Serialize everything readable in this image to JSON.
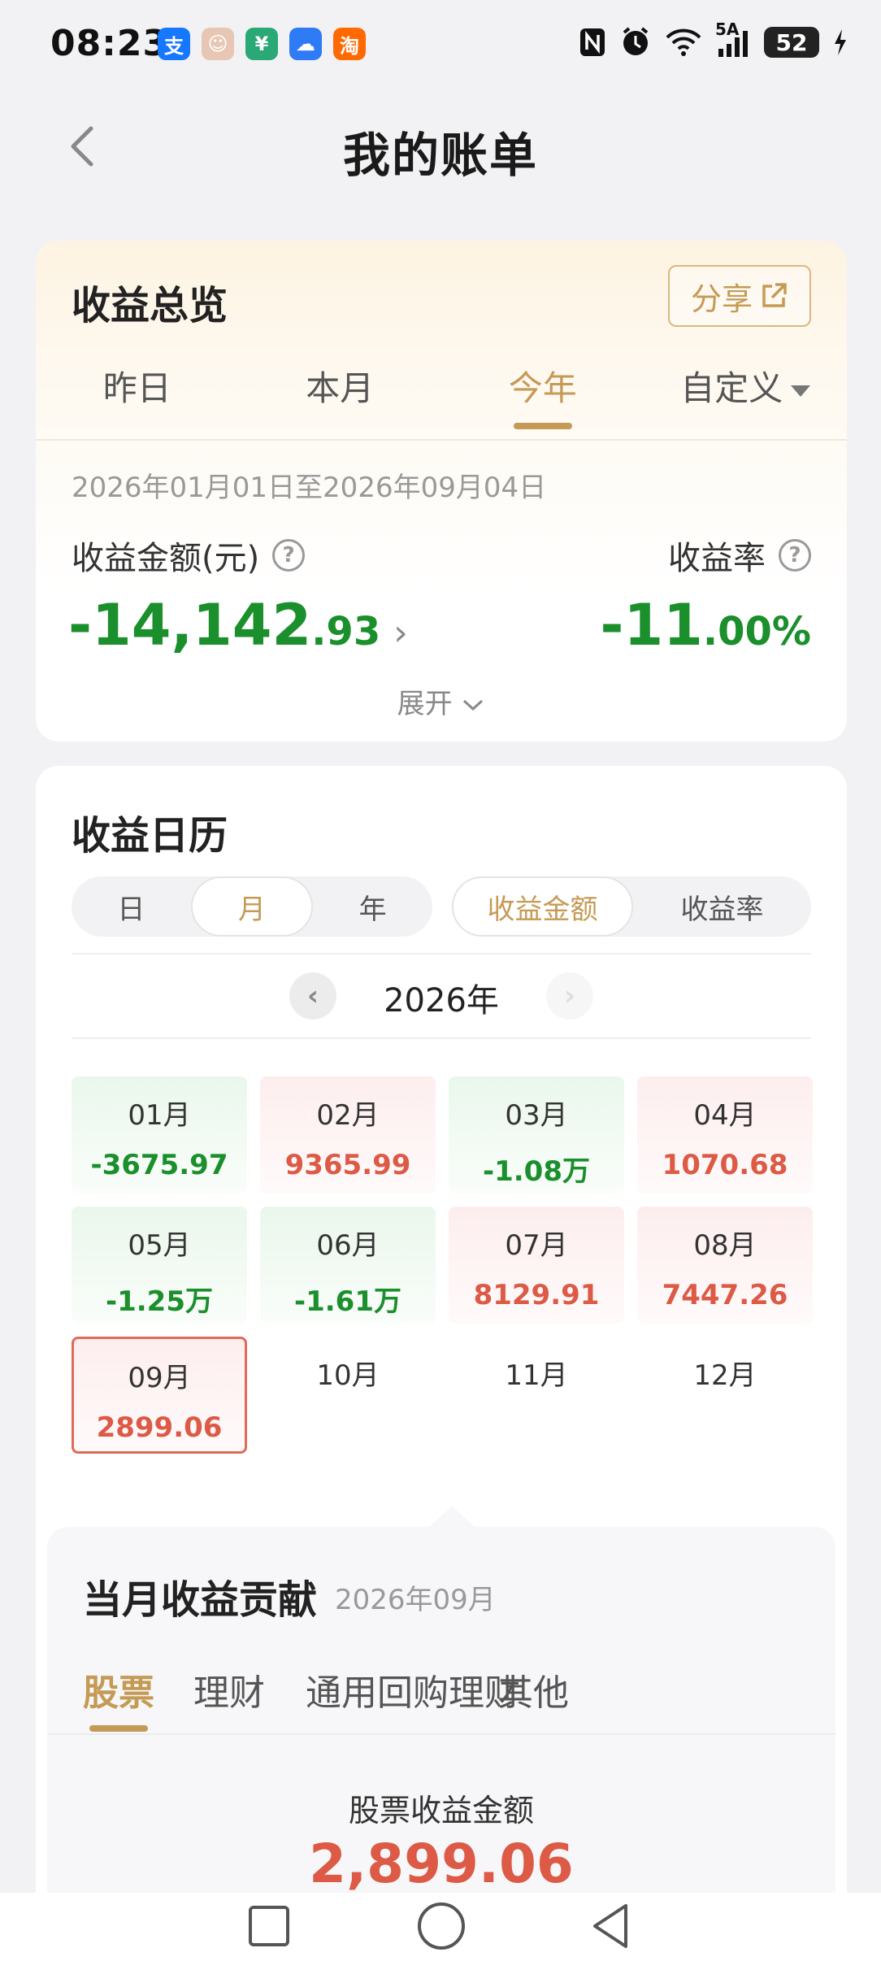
{
  "status_bar": {
    "time": "08:23",
    "apps": [
      {
        "icon": "alipay-icon",
        "glyph": "支",
        "color": "#1677ff"
      },
      {
        "icon": "avatar-app-icon",
        "glyph": "☺",
        "color": "#e8c6b4"
      },
      {
        "icon": "bank-app-icon",
        "glyph": "¥",
        "color": "#2aa876"
      },
      {
        "icon": "cloud-app-icon",
        "glyph": "☁",
        "color": "#2f7bf5"
      },
      {
        "icon": "taobao-icon",
        "glyph": "淘",
        "color": "#ff6a00"
      }
    ],
    "signal_label": "5A",
    "battery": "52"
  },
  "header": {
    "title": "我的账单"
  },
  "overview": {
    "title": "收益总览",
    "share_label": "分享",
    "tabs": [
      {
        "label": "昨日",
        "active": false
      },
      {
        "label": "本月",
        "active": false
      },
      {
        "label": "今年",
        "active": true
      },
      {
        "label": "自定义",
        "active": false
      }
    ],
    "date_range": "2026年01月01日至2026年09月04日",
    "amount_label": "收益金额(元)",
    "amount_main": "-14,142",
    "amount_decimal": ".93",
    "rate_label": "收益率",
    "rate_main": "-11",
    "rate_decimal": ".00%",
    "expand_label": "展开"
  },
  "calendar": {
    "title": "收益日历",
    "period_options": [
      {
        "label": "日",
        "active": false
      },
      {
        "label": "月",
        "active": true
      },
      {
        "label": "年",
        "active": false
      }
    ],
    "metric_options": [
      {
        "label": "收益金额",
        "active": true
      },
      {
        "label": "收益率",
        "active": false
      }
    ],
    "year": "2026年",
    "months": [
      {
        "name": "01月",
        "value": "-3675.97",
        "type": "loss"
      },
      {
        "name": "02月",
        "value": "9365.99",
        "type": "gain"
      },
      {
        "name": "03月",
        "value": "-1.08万",
        "type": "loss"
      },
      {
        "name": "04月",
        "value": "1070.68",
        "type": "gain"
      },
      {
        "name": "05月",
        "value": "-1.25万",
        "type": "loss"
      },
      {
        "name": "06月",
        "value": "-1.61万",
        "type": "loss"
      },
      {
        "name": "07月",
        "value": "8129.91",
        "type": "gain"
      },
      {
        "name": "08月",
        "value": "7447.26",
        "type": "gain"
      },
      {
        "name": "09月",
        "value": "2899.06",
        "type": "selected"
      },
      {
        "name": "10月",
        "value": "",
        "type": "empty"
      },
      {
        "name": "11月",
        "value": "",
        "type": "empty"
      },
      {
        "name": "12月",
        "value": "",
        "type": "empty"
      }
    ]
  },
  "contribution": {
    "title": "当月收益贡献",
    "date": "2026年09月",
    "tabs": [
      "股票",
      "理财",
      "通用回购理财",
      "其他"
    ],
    "active_tab": "股票",
    "stock_label": "股票收益金额",
    "stock_amount": "2,899.06"
  },
  "colors": {
    "accent": "#c59a55",
    "loss": "#1a8f2c",
    "gain": "#dc5a46"
  }
}
